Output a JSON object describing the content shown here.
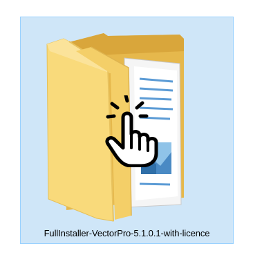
{
  "file": {
    "name": "FullInstaller-VectorPro-5.1.0.1-with-licence",
    "type_icon": "folder-icon",
    "selected": true
  },
  "cursor": {
    "icon": "hand-pointer-click-icon"
  },
  "colors": {
    "selection_fill": "#cfe6f8",
    "selection_border": "#99d1ff",
    "folder_front": "#f8d775",
    "folder_back": "#e0b44a",
    "document_lines": "#5b9bd5"
  }
}
